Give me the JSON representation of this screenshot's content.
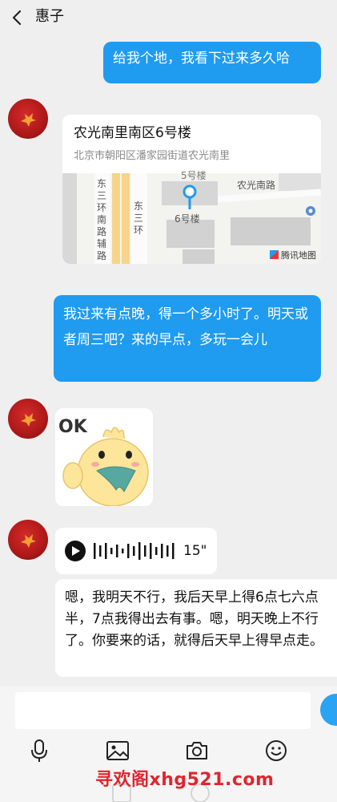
{
  "header": {
    "title": "惠子",
    "back_icon": "chevron-left-icon"
  },
  "messages": {
    "m1": {
      "text": "给我个地，我看下过来多久哈"
    },
    "location": {
      "title": "农光南里南区6号楼",
      "address": "北京市朝阳区潘家园街道农光南里",
      "map_labels": {
        "road_left": "东三环南路辅路",
        "road_mid": "东三环",
        "road_right": "农光南路",
        "building": "6号楼",
        "top_partial": "5号楼"
      },
      "map_attribution": "腾讯地图"
    },
    "m2": {
      "text": "我过来有点晚，得一个多小时了。明天或者周三吧？来的早点，多玩一会儿"
    },
    "sticker": {
      "text": "OK"
    },
    "voice": {
      "duration": "15\"",
      "transcript": "嗯，我明天不行，我后天早上得6点七六点半，7点我得出去有事。嗯，明天晚上不行了。你要来的话，就得后天早上得早点走。"
    }
  },
  "input_bar": {
    "placeholder": "",
    "tools": [
      "microphone-icon",
      "image-icon",
      "camera-icon",
      "emoji-icon"
    ]
  },
  "watermark": "寻欢阁xhg521.com",
  "colors": {
    "sent_bubble": "#1f9bf0",
    "background": "#efefef",
    "watermark": "#e0252e"
  }
}
